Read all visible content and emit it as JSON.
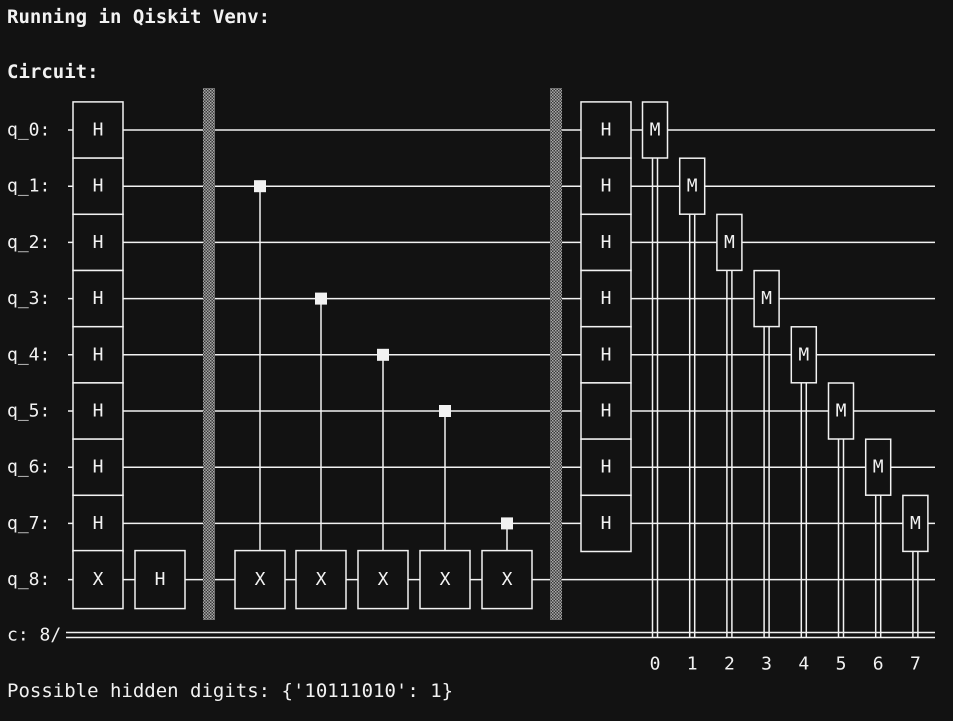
{
  "header": {
    "running_text": "Running in Qiskit Venv:",
    "circuit_label": "Circuit:"
  },
  "circuit": {
    "qubit_labels": [
      "q_0:",
      "q_1:",
      "q_2:",
      "q_3:",
      "q_4:",
      "q_5:",
      "q_6:",
      "q_7:",
      "q_8:"
    ],
    "classical_label": "c: 8/",
    "initial_h_label": "H",
    "ancilla_x_label": "X",
    "ancilla_h_label": "H",
    "cnot_controls": [
      1,
      3,
      4,
      5,
      7
    ],
    "cnot_target_label": "X",
    "final_h_label": "H",
    "measure_label": "M",
    "classical_bit_indices": [
      "0",
      "1",
      "2",
      "3",
      "4",
      "5",
      "6",
      "7"
    ]
  },
  "result": {
    "text": "Possible hidden digits: {'10111010': 1}"
  },
  "colors": {
    "background": "#121212",
    "foreground": "#f2f2f2",
    "barrier": "#8a8a8a"
  }
}
